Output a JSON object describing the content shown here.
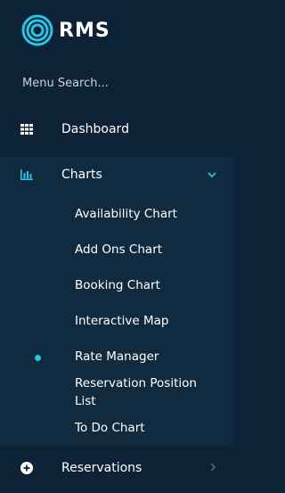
{
  "brand": {
    "name": "RMS"
  },
  "search": {
    "placeholder": "Menu Search..."
  },
  "nav": {
    "dashboard": {
      "label": "Dashboard",
      "icon": "grid-icon"
    },
    "charts": {
      "label": "Charts",
      "icon": "bar-chart-icon",
      "expanded": true,
      "items": [
        "Availability Chart",
        "Add Ons Chart",
        "Booking Chart",
        "Interactive Map",
        "Rate Manager",
        "Reservation Position List",
        "To Do Chart"
      ],
      "active_item": "Rate Manager"
    },
    "reservations": {
      "label": "Reservations",
      "icon": "plus-circle-icon"
    }
  },
  "colors": {
    "accent": "#25c6e3",
    "background": "#0d2236",
    "submenu_background": "#102b40"
  }
}
